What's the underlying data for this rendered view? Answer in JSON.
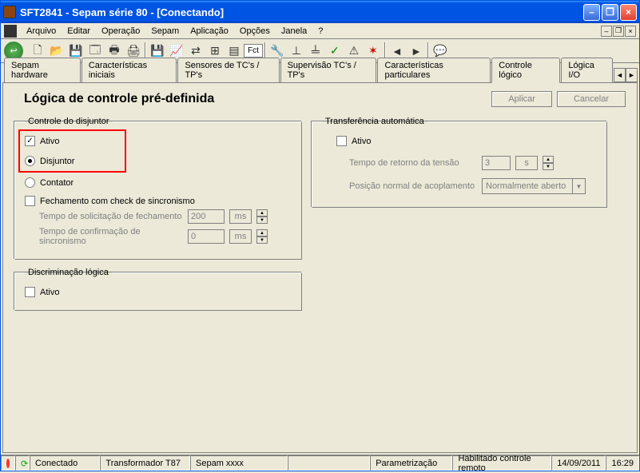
{
  "window": {
    "title": "SFT2841 - Sepam série 80 - [Conectando]"
  },
  "menu": {
    "arquivo": "Arquivo",
    "editar": "Editar",
    "operacao": "Operação",
    "sepam": "Sepam",
    "aplicacao": "Aplicação",
    "opcoes": "Opções",
    "janela": "Janela",
    "help": "?"
  },
  "toolbar": {
    "fct": "Fct"
  },
  "tabs": {
    "hardware": "Sepam hardware",
    "caracteristicas": "Características iniciais",
    "sensores": "Sensores de TC's / TP's",
    "supervisao": "Supervisão TC's / TP's",
    "particulares": "Características particulares",
    "controle": "Controle lógico",
    "logica": "Lógica I/O"
  },
  "panel": {
    "title": "Lógica de controle pré-definida",
    "aplicar": "Aplicar",
    "cancelar": "Cancelar"
  },
  "disjuntor_group": {
    "legend": "Controle do disjuntor",
    "ativo": "Ativo",
    "ativo_checked": true,
    "disjuntor": "Disjuntor",
    "disjuntor_selected": true,
    "contator": "Contator",
    "fechamento": "Fechamento com check de sincronismo",
    "tempo_solicitacao_label": "Tempo de solicitação de fechamento",
    "tempo_solicitacao_value": "200",
    "tempo_confirmacao_label": "Tempo de confirmação de sincronismo",
    "tempo_confirmacao_value": "0",
    "unit": "ms"
  },
  "discriminacao_group": {
    "legend": "Discriminação lógica",
    "ativo": "Ativo"
  },
  "transferencia_group": {
    "legend": "Transferência automática",
    "ativo": "Ativo",
    "tempo_retorno_label": "Tempo de retorno da tensão",
    "tempo_retorno_value": "3",
    "tempo_retorno_unit": "s",
    "posicao_label": "Posição normal de acoplamento",
    "posicao_value": "Normalmente aberto"
  },
  "status": {
    "conectado": "Conectado",
    "transformador": "Transformador T87",
    "sepam": "Sepam xxxx",
    "parametrizacao": "Parametrização",
    "habilitado": "Habilitado controle remoto",
    "data": "14/09/2011",
    "hora": "16:29"
  }
}
